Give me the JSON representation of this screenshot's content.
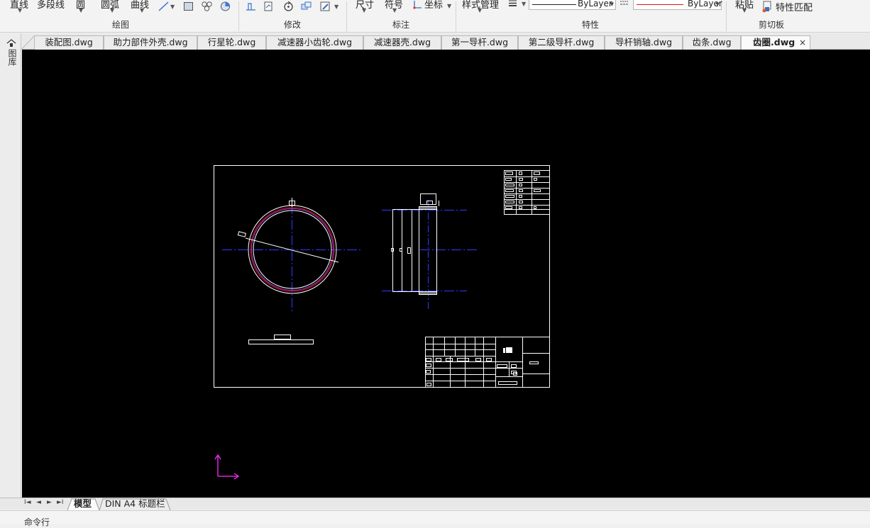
{
  "ribbon": {
    "draw_group": {
      "label": "绘图",
      "items": [
        {
          "label": "直线"
        },
        {
          "label": "多段线"
        },
        {
          "label": "圆"
        },
        {
          "label": "圆弧"
        },
        {
          "label": "曲线"
        }
      ]
    },
    "modify_group": {
      "label": "修改"
    },
    "annotate_group": {
      "label": "标注",
      "items": [
        {
          "label": "尺寸"
        },
        {
          "label": "符号"
        },
        {
          "label": "坐标"
        }
      ]
    },
    "properties_group": {
      "label": "特性",
      "style_manager": "样式管理",
      "linetype_value": "ByLayer",
      "color_value": "ByLayer"
    },
    "clipboard_group": {
      "label": "剪切板",
      "paste": "粘贴",
      "match_properties": "特性匹配"
    }
  },
  "document_tabs": [
    {
      "label": "装配图.dwg"
    },
    {
      "label": "助力部件外壳.dwg"
    },
    {
      "label": "行星轮.dwg"
    },
    {
      "label": "减速器小齿轮.dwg"
    },
    {
      "label": "减速器壳.dwg"
    },
    {
      "label": "第一导杆.dwg"
    },
    {
      "label": "第二级导杆.dwg"
    },
    {
      "label": "导杆销轴.dwg"
    },
    {
      "label": "齿条.dwg"
    },
    {
      "label": "齿圈.dwg"
    }
  ],
  "active_tab_close": "×",
  "left_panel": {
    "label": "图库"
  },
  "layout_tabs": [
    {
      "label": "模型"
    },
    {
      "label": "DIN A4 标题栏"
    }
  ],
  "command_line": {
    "label": "命令行"
  },
  "colors": {
    "canvas_bg": "#000000",
    "drawing_line": "#ffffff",
    "center_line": "#2b3cff",
    "gear_red": "#e0141e",
    "gear_purple": "#9b3dd6",
    "ucs_magenta": "#ff2cff",
    "bylayer_red": "#e01919"
  }
}
